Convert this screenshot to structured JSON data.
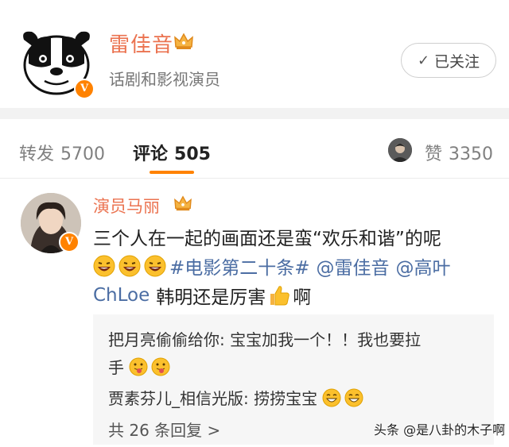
{
  "header": {
    "username": "雷佳音",
    "bio": "话剧和影视演员",
    "follow_button": "已关注",
    "verified_badge": "V",
    "crown_icon": "crown-icon"
  },
  "tabs": {
    "repost_label": "转发",
    "repost_count": "5700",
    "comments_label": "评论",
    "comments_count": "505",
    "likes_label": "赞",
    "likes_count": "3350",
    "active_tab": "评论"
  },
  "comment": {
    "author": "演员马丽",
    "verified_badge": "V",
    "line1": "三个人在一起的画面还是蛮“欢乐和谐”的呢",
    "hashtag": "#电影第二十条#",
    "mention1": "@雷佳音",
    "mention2_part1": "@高叶",
    "mention2_part2": "ChLoe",
    "line3_text": "韩明还是厉害",
    "line3_end": "啊"
  },
  "replies": {
    "reply1_line1": "把月亮偷偷给你: 宝宝加我一个！！我也要拉",
    "reply1_line2": "手",
    "reply2": "贾素芬儿_相信光版: 捞捞宝宝",
    "more": "共 26 条回复 >"
  },
  "watermark": "头条 @是八卦的木子啊",
  "colors": {
    "accent_orange": "#ff8200",
    "username_color": "#eb7350",
    "link_blue": "#4b6da3",
    "separator": "#f2f2f2",
    "reply_bg": "#f6f6f6"
  }
}
